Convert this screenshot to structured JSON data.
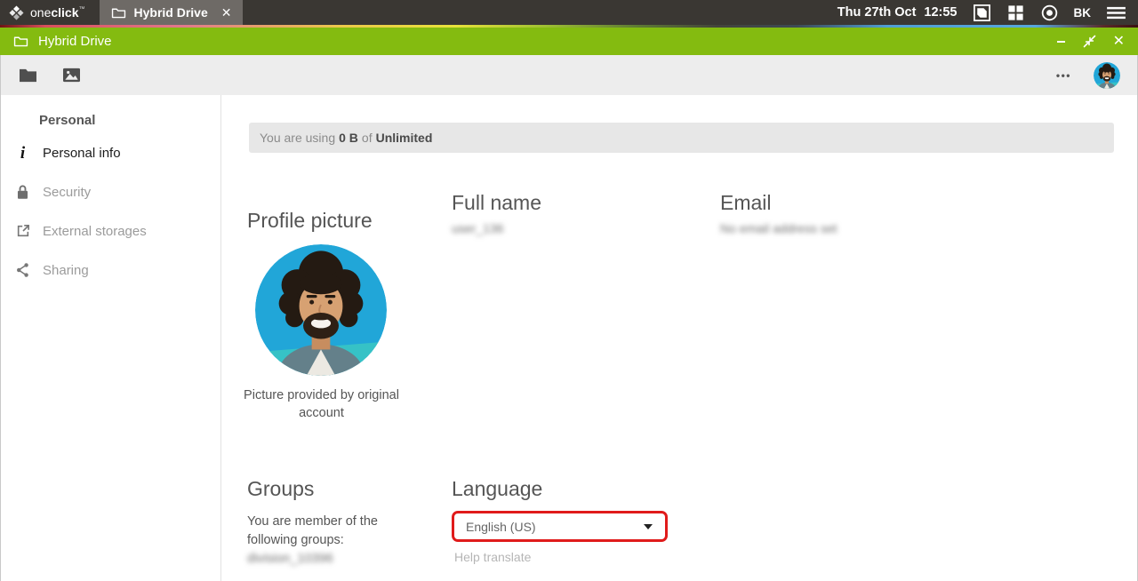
{
  "taskbar": {
    "brand": {
      "one": "one",
      "click": "click",
      "tm": "™"
    },
    "tab_label": "Hybrid Drive",
    "clock_date": "Thu 27th Oct",
    "clock_time": "12:55",
    "user_initials": "BK"
  },
  "icons": {
    "close": "✕",
    "minimize": "−",
    "more": "•••"
  },
  "titlebar": {
    "title": "Hybrid Drive"
  },
  "sidebar": {
    "heading": "Personal",
    "items": [
      {
        "label": "Personal info",
        "icon": "info-icon",
        "active": true
      },
      {
        "label": "Security",
        "icon": "lock-icon",
        "active": false
      },
      {
        "label": "External storages",
        "icon": "external-link-icon",
        "active": false
      },
      {
        "label": "Sharing",
        "icon": "share-icon",
        "active": false
      }
    ]
  },
  "content": {
    "quota": {
      "prefix": "You are using",
      "used": "0 B",
      "of": "of",
      "total": "Unlimited"
    },
    "profile": {
      "heading": "Profile picture",
      "caption": "Picture provided by original account"
    },
    "fullname": {
      "heading": "Full name",
      "value": "user_136"
    },
    "email": {
      "heading": "Email",
      "value": "No email address set"
    },
    "groups": {
      "heading": "Groups",
      "description": "You are member of the following groups:",
      "value": "division_10396"
    },
    "language": {
      "heading": "Language",
      "selected": "English (US)",
      "help": "Help translate"
    }
  },
  "colors": {
    "accent_green": "#84bb10",
    "annotation_red": "#e01b1b",
    "taskbar_dark": "#3a3733",
    "tab_gray": "#6e6a66"
  }
}
